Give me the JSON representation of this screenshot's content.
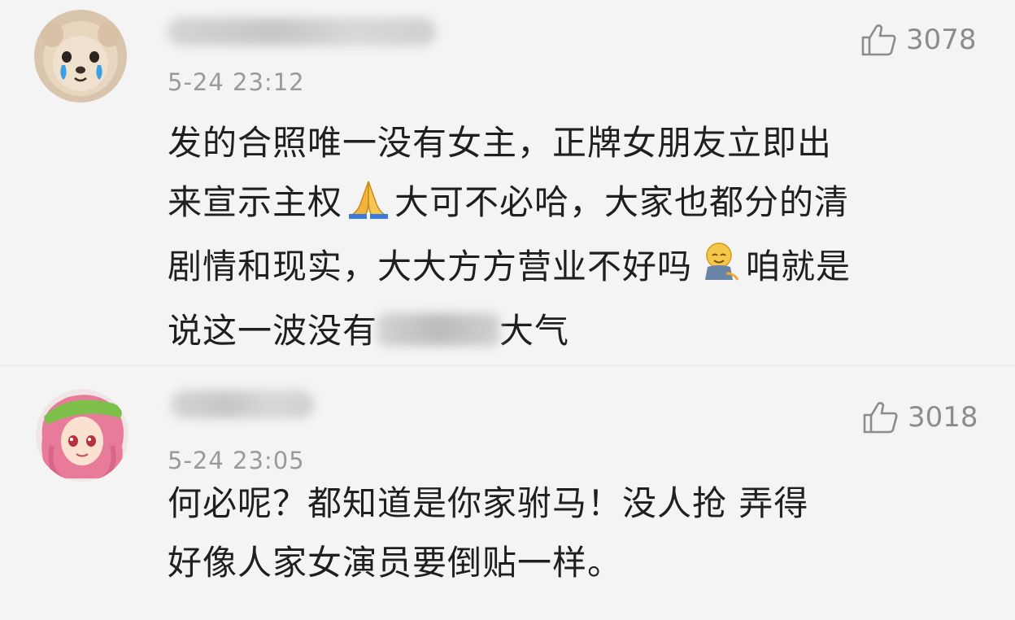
{
  "comments": [
    {
      "time": "5-24 23:12",
      "likes": "3078",
      "avatar_icon": "crying-dog-avatar",
      "username_blurred": true,
      "lines": [
        "发的合照唯一没有女主，正牌女朋友立即出",
        "来宣示主权",
        "大可不必哈，大家也都分的清",
        "剧情和现实，大大方方营业不好吗",
        "咱就是",
        "说这一波没有",
        "大气"
      ]
    },
    {
      "time": "5-24 23:05",
      "likes": "3018",
      "avatar_icon": "pink-hair-girl-avatar",
      "username_blurred": true,
      "lines": [
        "何必呢？都知道是你家驸马！没人抢  弄得",
        "好像人家女演员要倒贴一样。"
      ]
    }
  ],
  "colors": {
    "background": "#f4f4f4",
    "text": "#1f1f1f",
    "meta": "#9a9a9a",
    "like": "#8c8c8c"
  }
}
